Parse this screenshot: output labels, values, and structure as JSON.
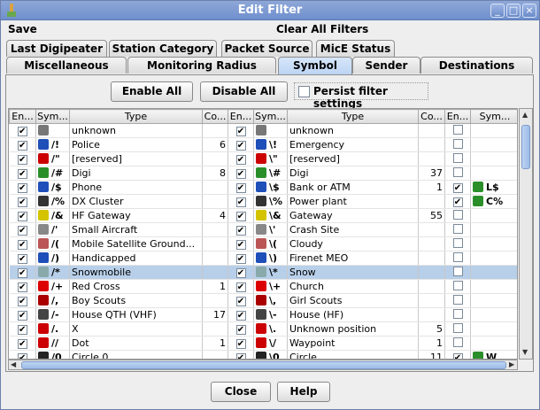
{
  "window": {
    "title": "Edit Filter"
  },
  "menu": {
    "save": "Save",
    "clear": "Clear All Filters"
  },
  "tabs_top": [
    "Last Digipeater",
    "Station Category",
    "Packet Source",
    "MicE Status"
  ],
  "tabs_bottom": [
    "Miscellaneous",
    "Monitoring Radius",
    "Symbol",
    "Sender",
    "Destinations"
  ],
  "active_tab": "Symbol",
  "buttons": {
    "enable_all": "Enable All",
    "disable_all": "Disable All",
    "close": "Close",
    "help": "Help"
  },
  "persist": {
    "label": "Persist filter settings",
    "checked": false
  },
  "columns": [
    "En...",
    "Sym...",
    "Type",
    "Co...",
    "En...",
    "Sym...",
    "Type",
    "Co...",
    "En...",
    "Sym..."
  ],
  "rows": [
    [
      "true",
      "",
      "unknown",
      "",
      "true",
      "",
      "unknown",
      "",
      "false",
      ""
    ],
    [
      "true",
      "/!",
      "Police",
      "6",
      "true",
      "\\!",
      "Emergency",
      "",
      "false",
      ""
    ],
    [
      "true",
      "/\"",
      "[reserved]",
      "",
      "true",
      "\\\"",
      "[reserved]",
      "",
      "false",
      ""
    ],
    [
      "true",
      "/#",
      "Digi",
      "8",
      "true",
      "\\#",
      "Digi",
      "37",
      "false",
      ""
    ],
    [
      "true",
      "/$",
      "Phone",
      "",
      "true",
      "\\$",
      "Bank or ATM",
      "1",
      "true",
      "L$"
    ],
    [
      "true",
      "/%",
      "DX Cluster",
      "",
      "true",
      "\\%",
      "Power plant",
      "",
      "true",
      "C%"
    ],
    [
      "true",
      "/&",
      "HF Gateway",
      "4",
      "true",
      "\\&",
      "Gateway",
      "55",
      "false",
      ""
    ],
    [
      "true",
      "/'",
      "Small Aircraft",
      "",
      "true",
      "\\'",
      "Crash Site",
      "",
      "false",
      ""
    ],
    [
      "true",
      "/(",
      "Mobile Satellite Ground...",
      "",
      "true",
      "\\(",
      "Cloudy",
      "",
      "false",
      ""
    ],
    [
      "true",
      "/)",
      "Handicapped",
      "",
      "true",
      "\\)",
      "Firenet MEO",
      "",
      "false",
      ""
    ],
    [
      "true",
      "/*",
      "Snowmobile",
      "",
      "true",
      "\\*",
      "Snow",
      "",
      "false",
      ""
    ],
    [
      "true",
      "/+",
      "Red Cross",
      "1",
      "true",
      "\\+",
      "Church",
      "",
      "false",
      ""
    ],
    [
      "true",
      "/,",
      "Boy Scouts",
      "",
      "true",
      "\\,",
      "Girl Scouts",
      "",
      "false",
      ""
    ],
    [
      "true",
      "/-",
      "House QTH (VHF)",
      "17",
      "true",
      "\\-",
      "House (HF)",
      "",
      "false",
      ""
    ],
    [
      "true",
      "/.",
      "X",
      "",
      "true",
      "\\.",
      "Unknown position",
      "5",
      "false",
      ""
    ],
    [
      "true",
      "//",
      "Dot",
      "1",
      "true",
      "\\/",
      "Waypoint",
      "1",
      "false",
      ""
    ],
    [
      "true",
      "/0",
      "Circle 0",
      "",
      "true",
      "\\0",
      "Circle",
      "11",
      "true",
      "W"
    ]
  ],
  "selected_row": 10
}
